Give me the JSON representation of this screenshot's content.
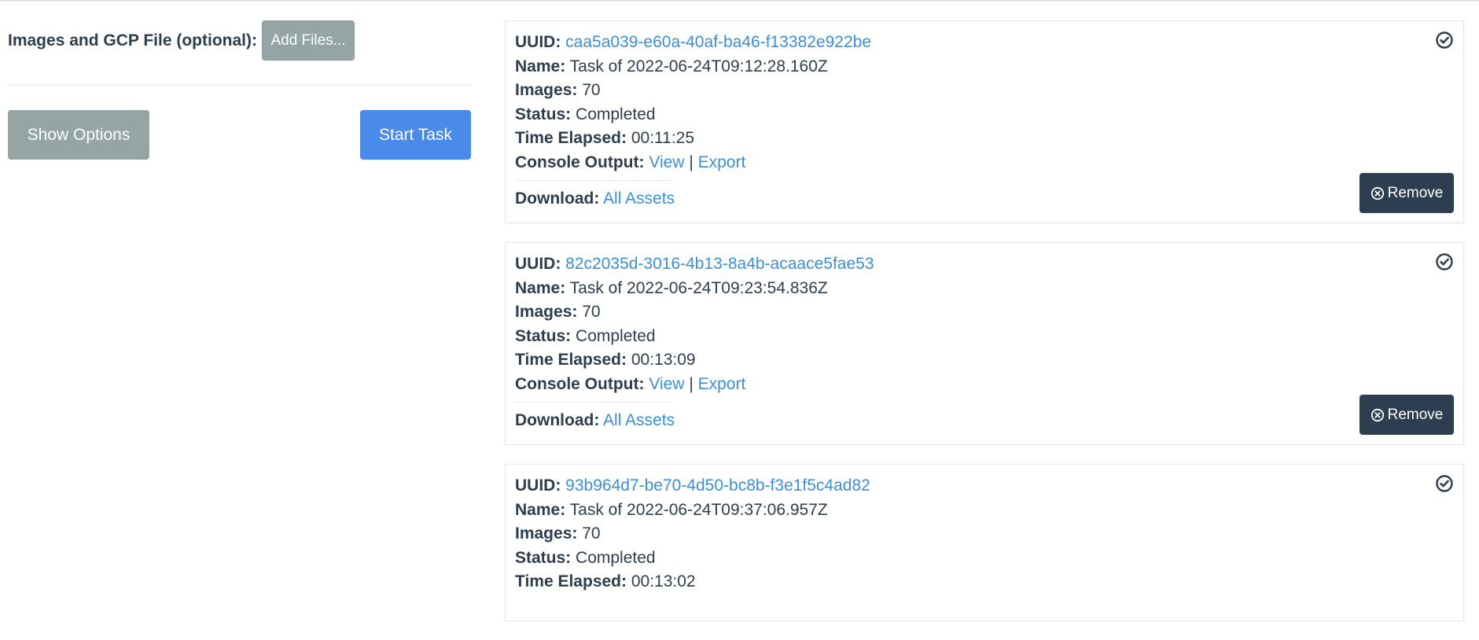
{
  "upload": {
    "label": "Images and GCP File (optional):",
    "add_files_label": "Add Files..."
  },
  "actions": {
    "show_options_label": "Show Options",
    "start_task_label": "Start Task"
  },
  "labels": {
    "uuid": "UUID:",
    "name": "Name:",
    "images": "Images:",
    "status": "Status:",
    "time_elapsed": "Time Elapsed:",
    "console_output": "Console Output:",
    "view": "View",
    "separator": "|",
    "export": "Export",
    "download": "Download:",
    "all_assets": "All Assets",
    "remove": "Remove"
  },
  "icons": {
    "status": "check-circle-icon",
    "remove": "times-circle-icon"
  },
  "colors": {
    "link": "#3b8fd6",
    "primary": "#4a8ae9",
    "secondary": "#95a5a6",
    "dark": "#2c3e50"
  },
  "tasks": [
    {
      "uuid": "caa5a039-e60a-40af-ba46-f13382e922be",
      "name": "Task of 2022-06-24T09:12:28.160Z",
      "images": "70",
      "status": "Completed",
      "time_elapsed": "00:11:25"
    },
    {
      "uuid": "82c2035d-3016-4b13-8a4b-acaace5fae53",
      "name": "Task of 2022-06-24T09:23:54.836Z",
      "images": "70",
      "status": "Completed",
      "time_elapsed": "00:13:09"
    },
    {
      "uuid": "93b964d7-be70-4d50-bc8b-f3e1f5c4ad82",
      "name": "Task of 2022-06-24T09:37:06.957Z",
      "images": "70",
      "status": "Completed",
      "time_elapsed": "00:13:02"
    }
  ]
}
